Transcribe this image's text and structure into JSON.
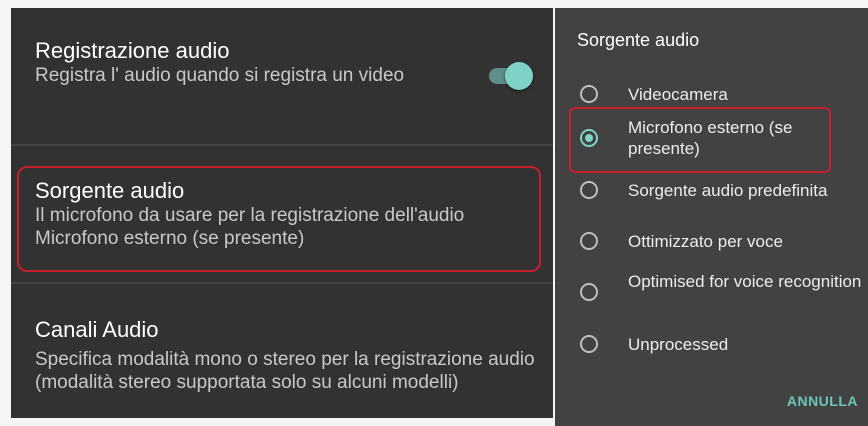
{
  "settings": {
    "audio_recording": {
      "title": "Registrazione audio",
      "description": "Registra l' audio quando si registra un video",
      "enabled": true
    },
    "audio_source": {
      "title": "Sorgente audio",
      "description": "Il microfono da usare per la registrazione dell'audio",
      "value": "Microfono esterno (se presente)"
    },
    "audio_channels": {
      "title": "Canali Audio",
      "description": "Specifica modalità mono o stereo per la registrazione audio (modalità stereo supportata solo su alcuni modelli)"
    }
  },
  "dialog": {
    "title": "Sorgente audio",
    "options": [
      {
        "label": "Videocamera",
        "selected": false
      },
      {
        "label": "Microfono esterno (se presente)",
        "selected": true
      },
      {
        "label": "Sorgente audio predefinita",
        "selected": false
      },
      {
        "label": "Ottimizzato per voce",
        "selected": false
      },
      {
        "label": "Optimised for voice recognition",
        "selected": false
      },
      {
        "label": "Unprocessed",
        "selected": false
      }
    ],
    "cancel_label": "ANNULLA"
  },
  "colors": {
    "accent": "#7fd3c6",
    "highlight": "#c41f2b",
    "panel": "#323232",
    "dialog": "#424242"
  }
}
